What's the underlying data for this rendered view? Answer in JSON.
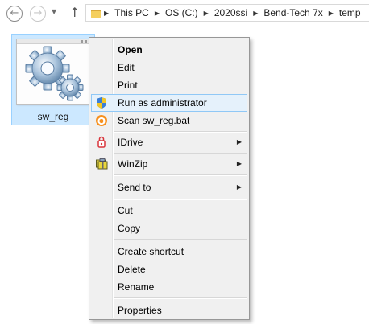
{
  "address_bar": {
    "crumbs": [
      "This PC",
      "OS (C:)",
      "2020ssi",
      "Bend-Tech 7x",
      "temp"
    ]
  },
  "file": {
    "name": "sw_reg"
  },
  "context_menu": {
    "open": "Open",
    "edit": "Edit",
    "print": "Print",
    "run_as_admin": "Run as administrator",
    "scan": "Scan sw_reg.bat",
    "idrive": "IDrive",
    "winzip": "WinZip",
    "send_to": "Send to",
    "cut": "Cut",
    "copy": "Copy",
    "create_shortcut": "Create shortcut",
    "delete": "Delete",
    "rename": "Rename",
    "properties": "Properties"
  },
  "colors": {
    "selection_bg": "#cce8ff",
    "menu_hover_bg": "#e5f1fb",
    "menu_hover_border": "#90c8f6",
    "menu_bg": "#f0f0f0"
  },
  "icons": {
    "back": "back-arrow-icon",
    "forward": "forward-arrow-icon",
    "up": "up-arrow-icon",
    "folder": "folder-icon",
    "file": "gears-icon",
    "run_as_admin": "uac-shield-icon",
    "scan": "avast-icon",
    "idrive": "idrive-icon",
    "winzip": "winzip-icon"
  }
}
